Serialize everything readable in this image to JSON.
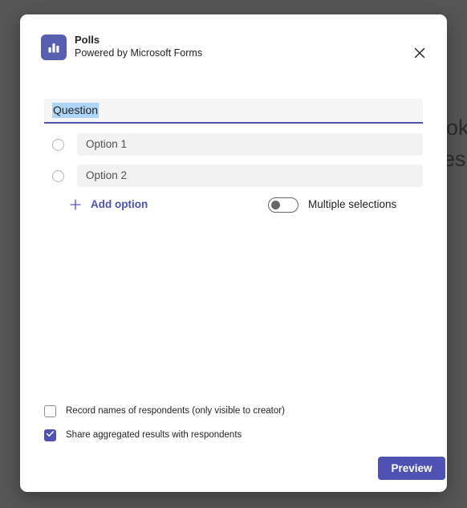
{
  "overlay": {
    "background_color": "#565656",
    "partial_text_fragments": [
      "ok",
      "es"
    ]
  },
  "dialog": {
    "header": {
      "app_icon": "bar-chart-icon",
      "title": "Polls",
      "subtitle": "Powered by Microsoft Forms",
      "close_label": "Close",
      "accent_color": "#4f52b2",
      "icon_background": "#585fb0"
    },
    "question": {
      "value": "Question",
      "placeholder": "Question",
      "selected": true,
      "selection_color": "#aed5f7",
      "field_background": "#f5f5f5",
      "focus_underline_color": "#4f52b2"
    },
    "options": [
      {
        "radio_state": "unselected",
        "value": "",
        "placeholder": "Option 1"
      },
      {
        "radio_state": "unselected",
        "value": "",
        "placeholder": "Option 2"
      }
    ],
    "add_option": {
      "icon": "plus-icon",
      "label": "Add option",
      "color": "#4f52b2"
    },
    "multiple_selections": {
      "label": "Multiple selections",
      "checked": false,
      "state": "off"
    },
    "settings": [
      {
        "label": "Record names of respondents (only visible to creator)",
        "checked": false
      },
      {
        "label": "Share aggregated results with respondents",
        "checked": true
      }
    ],
    "footer": {
      "primary_button": "Preview",
      "primary_button_color": "#4f52b2"
    }
  }
}
